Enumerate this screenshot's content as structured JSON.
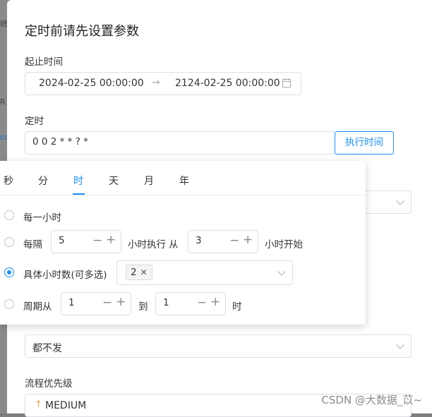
{
  "background_fragments": [
    "统",
    "R",
    "co"
  ],
  "dialog": {
    "title": "定时前请先设置参数",
    "start_end_label": "起止时间",
    "start_time": "2024-02-25 00:00:00",
    "range_separator": "→",
    "end_time": "2124-02-25 00:00:00",
    "cron_label": "定时",
    "cron_value": "0 0 2 * * ? *",
    "exec_time_button": "执行时间",
    "notify_value": "都不发",
    "priority_label": "流程优先级",
    "priority_value": "MEDIUM",
    "priority_icon": "arrow-up-icon"
  },
  "cron_popover": {
    "tabs": [
      "秒",
      "分",
      "时",
      "天",
      "月",
      "年"
    ],
    "active_tab": "时",
    "options": {
      "every_hour": "每一小时",
      "interval_prefix": "每隔",
      "interval_value": "5",
      "interval_mid": "小时执行 从",
      "interval_start": "3",
      "interval_suffix": "小时开始",
      "specific_label": "具体小时数(可多选)",
      "specific_tag": "2",
      "cycle_prefix": "周期从",
      "cycle_from": "1",
      "cycle_to_label": "到",
      "cycle_to": "1",
      "cycle_suffix": "时"
    },
    "selected_option": "specific"
  },
  "watermark": "CSDN @大数据_苡~",
  "colors": {
    "accent": "#1890ff",
    "border": "#dcdfe6",
    "priority_arrow": "#f0a040"
  }
}
